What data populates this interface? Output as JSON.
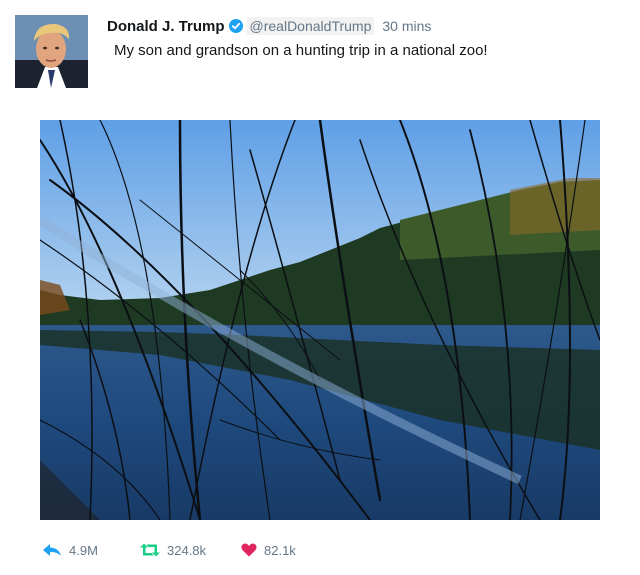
{
  "author": {
    "name": "Donald J. Trump",
    "handle": "@realDonaldTrump",
    "verified": true,
    "time": "30 mins"
  },
  "tweet": {
    "text": "My son and grandson on a hunting trip in a national zoo!"
  },
  "actions": {
    "reply_count": "4.9M",
    "retweet_count": "324.8k",
    "like_count": "82.1k"
  },
  "icons": {
    "reply": "reply-arrow-icon",
    "retweet": "retweet-icon",
    "like": "heart-icon",
    "verified": "verified-badge-icon"
  },
  "colors": {
    "accent": "#1da1f2",
    "like": "#e0245e",
    "muted": "#657786"
  }
}
